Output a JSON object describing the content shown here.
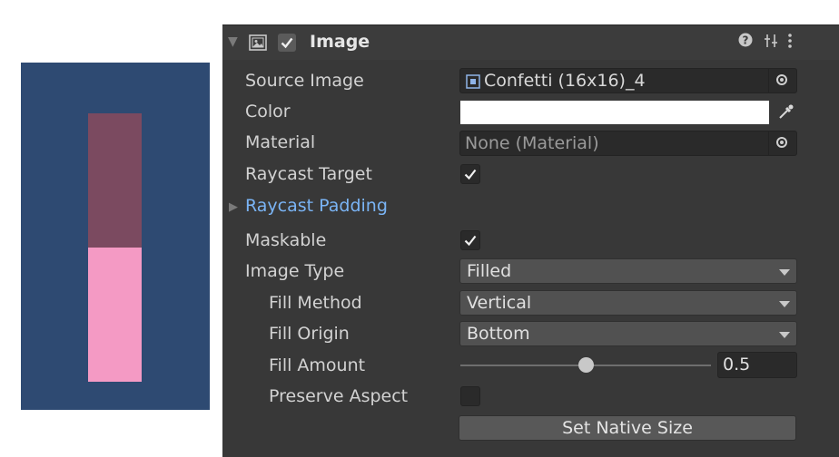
{
  "preview": {
    "background": "#2e4a72",
    "empty_color": "#7b4a60",
    "fill_color": "#f49ac4",
    "fill_amount": 0.5
  },
  "component": {
    "title": "Image",
    "enabled": true,
    "icons": [
      "image-component-icon",
      "help-icon",
      "presets-icon",
      "kebab-menu-icon"
    ]
  },
  "fields": {
    "source_image": {
      "label": "Source Image",
      "value": "Confetti (16x16)_4"
    },
    "color": {
      "label": "Color",
      "value": "#ffffff"
    },
    "material": {
      "label": "Material",
      "value": "None (Material)"
    },
    "raycast_target": {
      "label": "Raycast Target",
      "checked": true
    },
    "raycast_padding": {
      "label": "Raycast Padding"
    },
    "maskable": {
      "label": "Maskable",
      "checked": true
    },
    "image_type": {
      "label": "Image Type",
      "value": "Filled"
    },
    "fill_method": {
      "label": "Fill Method",
      "value": "Vertical"
    },
    "fill_origin": {
      "label": "Fill Origin",
      "value": "Bottom"
    },
    "fill_amount": {
      "label": "Fill Amount",
      "value": "0.5",
      "fraction": 0.5
    },
    "preserve_aspect": {
      "label": "Preserve Aspect",
      "checked": false
    }
  },
  "buttons": {
    "set_native_size": "Set Native Size"
  }
}
